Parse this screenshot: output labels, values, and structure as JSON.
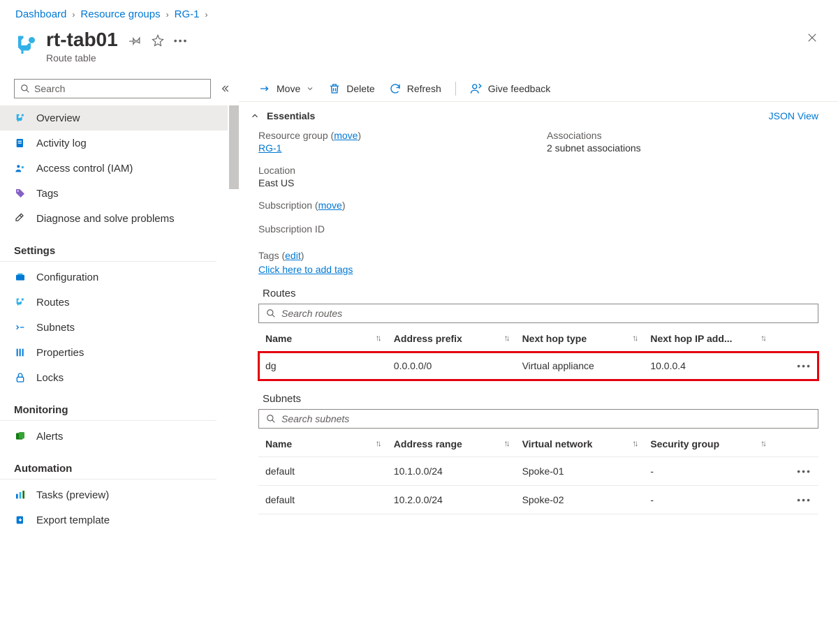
{
  "breadcrumb": {
    "items": [
      "Dashboard",
      "Resource groups",
      "RG-1"
    ]
  },
  "header": {
    "title": "rt-tab01",
    "subtitle": "Route table"
  },
  "sidebar": {
    "search_placeholder": "Search",
    "items": [
      {
        "label": "Overview"
      },
      {
        "label": "Activity log"
      },
      {
        "label": "Access control (IAM)"
      },
      {
        "label": "Tags"
      },
      {
        "label": "Diagnose and solve problems"
      }
    ],
    "settings_header": "Settings",
    "settings": [
      {
        "label": "Configuration"
      },
      {
        "label": "Routes"
      },
      {
        "label": "Subnets"
      },
      {
        "label": "Properties"
      },
      {
        "label": "Locks"
      }
    ],
    "monitoring_header": "Monitoring",
    "monitoring": [
      {
        "label": "Alerts"
      }
    ],
    "automation_header": "Automation",
    "automation": [
      {
        "label": "Tasks (preview)"
      },
      {
        "label": "Export template"
      }
    ]
  },
  "toolbar": {
    "move": "Move",
    "delete": "Delete",
    "refresh": "Refresh",
    "feedback": "Give feedback"
  },
  "essentials": {
    "heading": "Essentials",
    "json_view": "JSON View",
    "rg_label": "Resource group",
    "rg_move": "move",
    "rg_value": "RG-1",
    "loc_label": "Location",
    "loc_value": "East US",
    "sub_label": "Subscription",
    "sub_move": "move",
    "sub_value": "",
    "subid_label": "Subscription ID",
    "assoc_label": "Associations",
    "assoc_value": "2 subnet associations",
    "tags_label": "Tags",
    "tags_edit": "edit",
    "tags_link": "Click here to add tags"
  },
  "routes": {
    "heading": "Routes",
    "search_placeholder": "Search routes",
    "columns": [
      "Name",
      "Address prefix",
      "Next hop type",
      "Next hop IP add..."
    ],
    "rows": [
      {
        "name": "dg",
        "prefix": "0.0.0.0/0",
        "hop_type": "Virtual appliance",
        "hop_ip": "10.0.0.4",
        "highlight": true
      }
    ]
  },
  "subnets": {
    "heading": "Subnets",
    "search_placeholder": "Search subnets",
    "columns": [
      "Name",
      "Address range",
      "Virtual network",
      "Security group"
    ],
    "rows": [
      {
        "name": "default",
        "range": "10.1.0.0/24",
        "vnet": "Spoke-01",
        "sg": "-"
      },
      {
        "name": "default",
        "range": "10.2.0.0/24",
        "vnet": "Spoke-02",
        "sg": "-"
      }
    ]
  }
}
